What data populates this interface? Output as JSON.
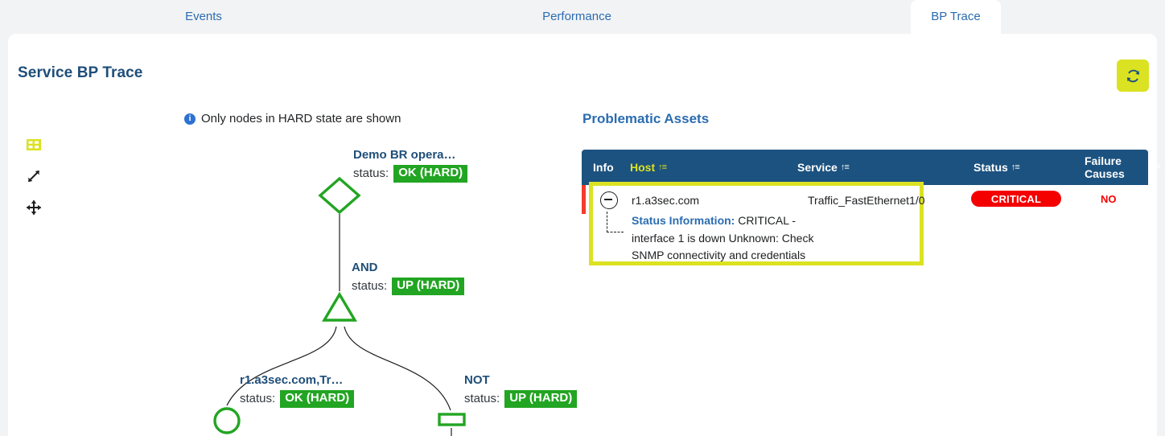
{
  "tabs": [
    {
      "label": "Events",
      "active": false
    },
    {
      "label": "Performance",
      "active": false
    },
    {
      "label": "BP Trace",
      "active": true
    }
  ],
  "header": {
    "title": "Service BP Trace",
    "refresh_icon": "refresh-icon",
    "refresh_color": "#dbe222"
  },
  "toolbar": {
    "layout_icon": "grid-layout-icon",
    "expand_icon": "expand-arrows-icon",
    "move_icon": "move-arrows-icon",
    "active_color": "#dbe222"
  },
  "info_note": {
    "icon": "info-icon",
    "text": "Only nodes in HARD state are shown"
  },
  "diagram": {
    "status_word": "status:",
    "node_color": "#22a522",
    "nodes": [
      {
        "shape": "diamond",
        "label": "Demo BR opera…",
        "status": "OK (HARD)"
      },
      {
        "shape": "triangle",
        "label": "AND",
        "status": "UP (HARD)"
      },
      {
        "shape": "circle",
        "label": "r1.a3sec.com,Tr…",
        "status": "OK (HARD)"
      },
      {
        "shape": "rectangle",
        "label": "NOT",
        "status": "UP (HARD)"
      }
    ]
  },
  "assets": {
    "title": "Problematic Assets",
    "header_bg": "#1c527f",
    "sort_icon": "sort-ascending-icon",
    "columns": [
      {
        "label": "Info",
        "sortable": false,
        "sorted": false
      },
      {
        "label": "Host",
        "sortable": true,
        "sorted": true
      },
      {
        "label": "Service",
        "sortable": true,
        "sorted": false
      },
      {
        "label": "Status",
        "sortable": true,
        "sorted": false
      },
      {
        "label": "Failure Causes",
        "sortable": true,
        "sorted": false
      }
    ],
    "rows": [
      {
        "collapse_icon": "minus-circle-icon",
        "host": "r1.a3sec.com",
        "service": "Traffic_FastEthernet1/0",
        "status": "CRITICAL",
        "status_color": "#f50000",
        "failure_causes": "NO",
        "detail_label": "Status Information:",
        "detail_text": " CRITICAL - interface 1 is down Unknown: Check SNMP connectivity and credentials",
        "highlighted": true,
        "highlight_color": "#dbe222"
      }
    ]
  }
}
